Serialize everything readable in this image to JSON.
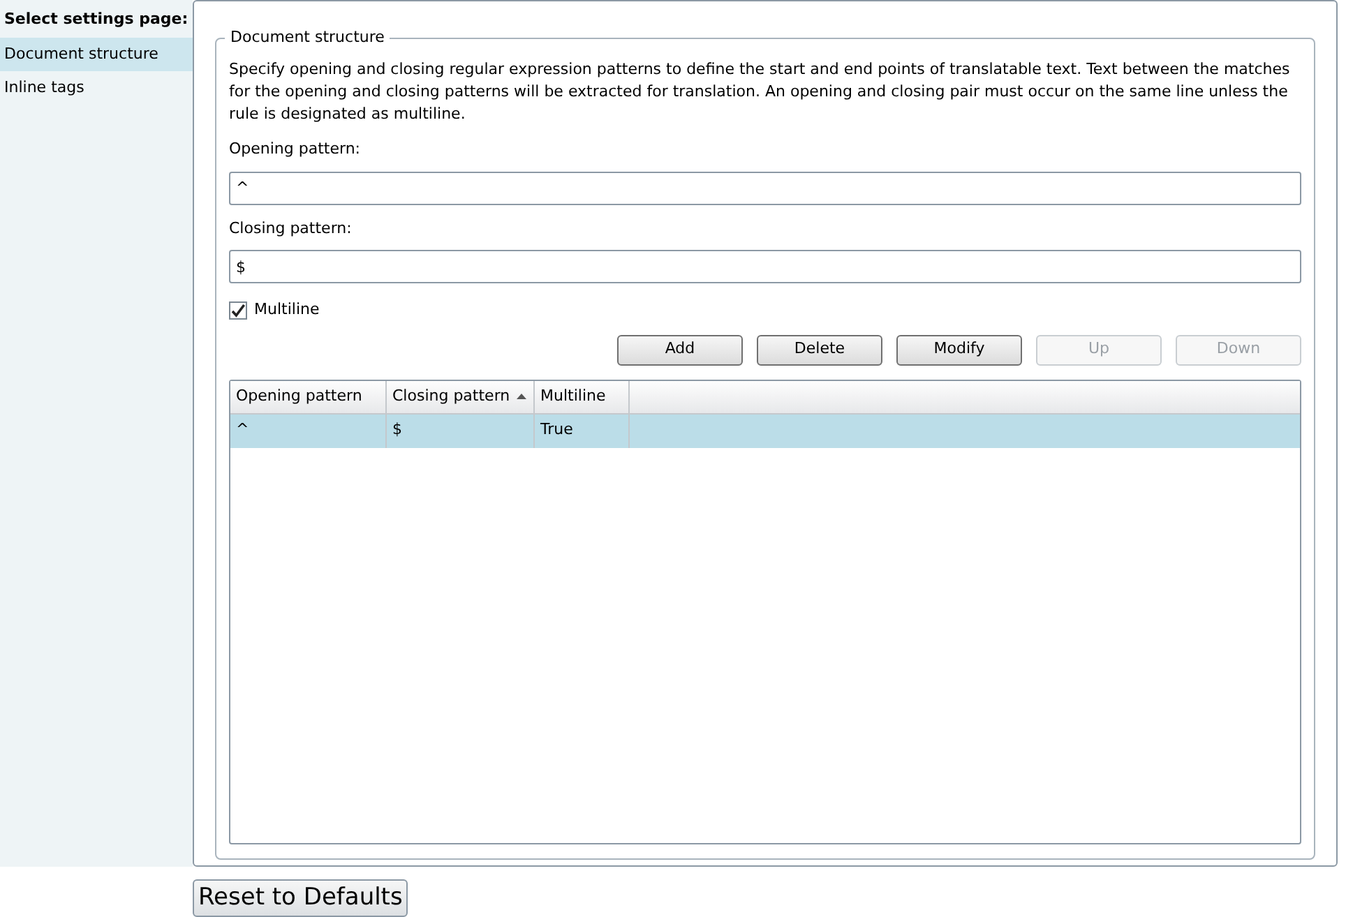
{
  "sidebar": {
    "heading": "Select settings page:",
    "items": [
      {
        "label": "Document structure",
        "selected": true
      },
      {
        "label": "Inline tags",
        "selected": false
      }
    ]
  },
  "group": {
    "title": "Document structure",
    "description": "Specify opening and closing regular expression patterns to define the start and end points of translatable text. Text between the matches for the opening and closing patterns will be extracted for translation. An opening and closing pair must occur on the same line unless the rule is designated as multiline.",
    "fields": [
      {
        "label": "Opening pattern:",
        "value": "^"
      },
      {
        "label": "Closing pattern:",
        "value": "$"
      }
    ],
    "multiline": {
      "label": "Multiline",
      "checked": true
    },
    "buttons": [
      {
        "label": "Add",
        "disabled": false
      },
      {
        "label": "Delete",
        "disabled": false
      },
      {
        "label": "Modify",
        "disabled": false
      },
      {
        "label": "Up",
        "disabled": true
      },
      {
        "label": "Down",
        "disabled": true
      }
    ],
    "table": {
      "columns": [
        {
          "label": "Opening pattern",
          "sorted": false
        },
        {
          "label": "Closing pattern",
          "sorted": true
        },
        {
          "label": "Multiline",
          "sorted": false
        }
      ],
      "rows": [
        {
          "cells": [
            "^",
            "$",
            "True"
          ],
          "selected": true
        }
      ]
    }
  },
  "reset_button": "Reset to Defaults"
}
